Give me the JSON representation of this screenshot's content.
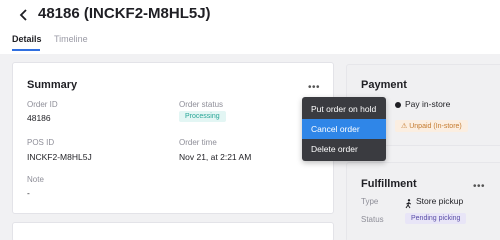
{
  "header": {
    "back_icon": "chevron-left-icon",
    "title": "48186 (INCKF2-M8HL5J)"
  },
  "tabs": [
    {
      "label": "Details",
      "active": true
    },
    {
      "label": "Timeline",
      "active": false
    }
  ],
  "summary": {
    "title": "Summary",
    "more_icon": "ellipsis-icon",
    "order_id_label": "Order ID",
    "order_id": "48186",
    "order_status_label": "Order status",
    "order_status": "Processing",
    "pos_id_label": "POS ID",
    "pos_id": "INCKF2-M8HL5J",
    "order_time_label": "Order time",
    "order_time": "Nov 21, at 2:21 AM",
    "note_label": "Note",
    "note": "-"
  },
  "menu": {
    "items": [
      {
        "label": "Put order on hold",
        "highlighted": false
      },
      {
        "label": "Cancel order",
        "highlighted": true
      },
      {
        "label": "Delete order",
        "highlighted": false
      }
    ]
  },
  "payment": {
    "title": "Payment",
    "method": "Pay in-store",
    "status": "Unpaid (In-store)",
    "status_icon": "warning-triangle-icon"
  },
  "fulfillment": {
    "title": "Fulfillment",
    "more_icon": "ellipsis-icon",
    "type_label": "Type",
    "type_value": "Store pickup",
    "type_icon": "walking-person-icon",
    "status_label": "Status",
    "status_value": "Pending picking"
  },
  "colors": {
    "accent": "#2f6fe0",
    "menu_bg": "#3a3b40",
    "menu_highlight": "#2f86e8",
    "processing": "#27a596",
    "unpaid": "#c47a2e",
    "pending": "#5a4ea8"
  }
}
